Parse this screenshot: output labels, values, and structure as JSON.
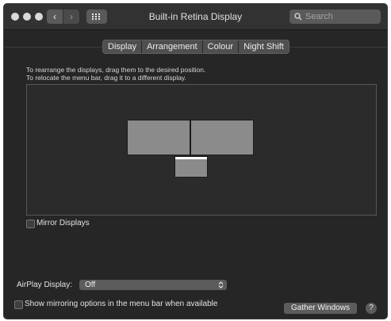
{
  "window": {
    "title": "Built-in Retina Display"
  },
  "toolbar": {
    "back_glyph": "‹",
    "forward_glyph": "›",
    "grid_icon": "show-all-grid-icon",
    "search_placeholder": "Search"
  },
  "tabs": [
    {
      "label": "Display",
      "selected": false
    },
    {
      "label": "Arrangement",
      "selected": true
    },
    {
      "label": "Colour",
      "selected": false
    },
    {
      "label": "Night Shift",
      "selected": false
    }
  ],
  "instructions": {
    "line1": "To rearrange the displays, drag them to the desired position.",
    "line2": "To relocate the menu bar, drag it to a different display."
  },
  "arrangement": {
    "displays": [
      "display-left",
      "display-right",
      "display-main-with-menubar"
    ],
    "menubar_color": "#ffffff"
  },
  "mirror": {
    "label": "Mirror Displays",
    "checked": false
  },
  "airplay": {
    "label": "AirPlay Display:",
    "value": "Off"
  },
  "mirroring_options": {
    "label": "Show mirroring options in the menu bar when available",
    "checked": false
  },
  "buttons": {
    "gather": "Gather Windows",
    "help": "?"
  },
  "colors": {
    "window_bg": "#262626",
    "control_bg": "#5c5c5c",
    "display_fill": "#8b8b8b"
  }
}
